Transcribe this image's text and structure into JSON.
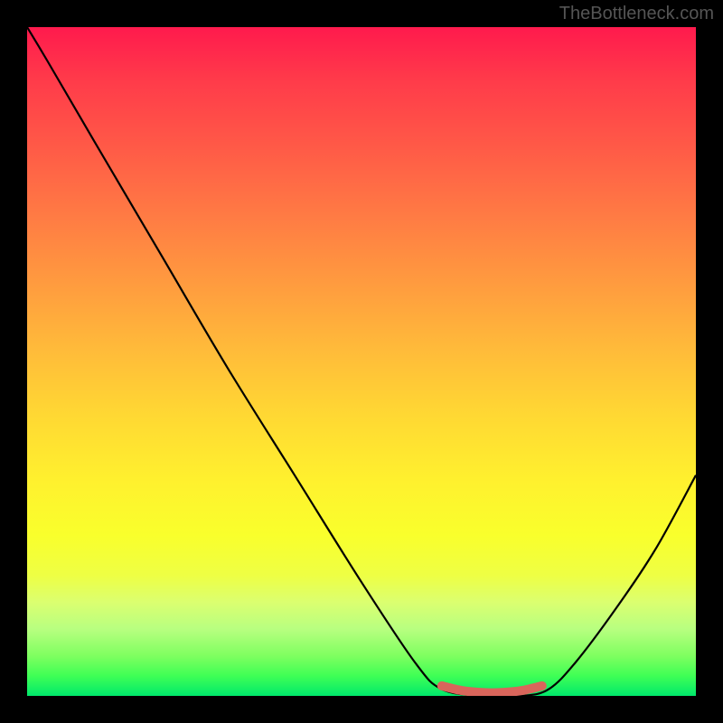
{
  "watermark": "TheBottleneck.com",
  "chart_data": {
    "type": "line",
    "title": "",
    "xlabel": "",
    "ylabel": "",
    "xlim": [
      0,
      100
    ],
    "ylim": [
      0,
      100
    ],
    "series": [
      {
        "name": "bottleneck-curve",
        "x": [
          0,
          3,
          10,
          20,
          30,
          40,
          50,
          58,
          62,
          68,
          74,
          78,
          82,
          88,
          94,
          100
        ],
        "y": [
          100,
          95,
          83,
          66,
          49,
          33,
          17,
          5,
          1,
          0,
          0,
          1,
          5,
          13,
          22,
          33
        ],
        "color": "#000000"
      },
      {
        "name": "optimal-range-marker",
        "x": [
          62,
          65,
          68,
          71,
          74,
          77
        ],
        "y": [
          1.5,
          0.8,
          0.5,
          0.5,
          0.8,
          1.5
        ],
        "color": "#d9655b"
      }
    ],
    "gradient_stops": [
      {
        "pos": 0,
        "color": "#ff1a4d"
      },
      {
        "pos": 50,
        "color": "#ffba3a"
      },
      {
        "pos": 75,
        "color": "#fff12e"
      },
      {
        "pos": 100,
        "color": "#00e86b"
      }
    ]
  }
}
